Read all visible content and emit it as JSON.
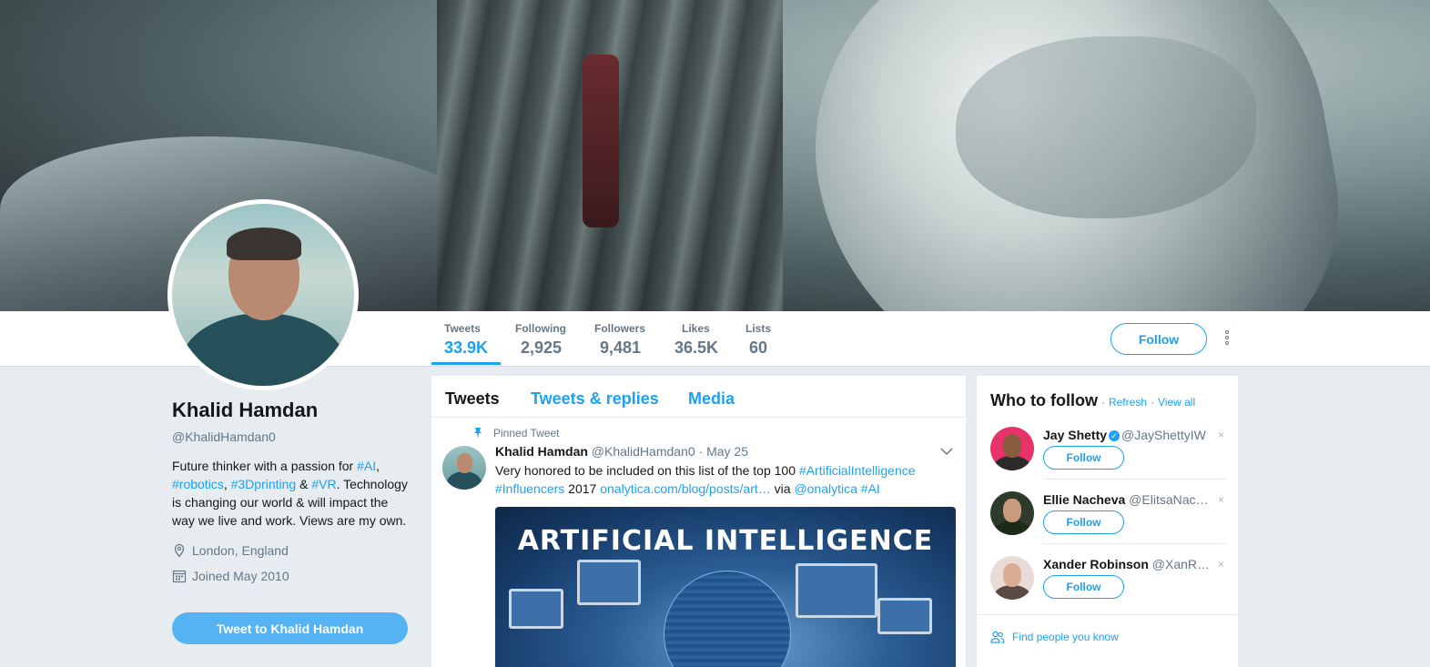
{
  "colors": {
    "accent": "#1da1f2",
    "muted": "#657786",
    "background": "#e6ecf0"
  },
  "profile": {
    "name": "Khalid Hamdan",
    "handle": "@KhalidHamdan0",
    "bio_1": "Future thinker with a passion for ",
    "bio_tag_ai": "#AI",
    "bio_2": ", ",
    "bio_tag_robotics": "#robotics",
    "bio_3": ", ",
    "bio_tag_3d": "#3Dprinting",
    "bio_4": " & ",
    "bio_tag_vr": "#VR",
    "bio_5": ". Technology is changing our world & will impact the way we live and work. Views are my own.",
    "location": "London, England",
    "joined": "Joined May 2010",
    "tweet_to_label": "Tweet to Khalid Hamdan"
  },
  "stats": [
    {
      "label": "Tweets",
      "value": "33.9K"
    },
    {
      "label": "Following",
      "value": "2,925"
    },
    {
      "label": "Followers",
      "value": "9,481"
    },
    {
      "label": "Likes",
      "value": "36.5K"
    },
    {
      "label": "Lists",
      "value": "60"
    }
  ],
  "nav": {
    "follow_label": "Follow"
  },
  "timeline": {
    "tabs": [
      "Tweets",
      "Tweets & replies",
      "Media"
    ],
    "pinned_label": "Pinned Tweet",
    "tweet": {
      "name": "Khalid Hamdan",
      "handle": "@KhalidHamdan0",
      "date": "· May 25",
      "text_1": "Very honored to be included on this list of the top 100 ",
      "tag_1": "#ArtificialIntelligence",
      "tag_2": "#Influencers",
      "text_2": " 2017 ",
      "link": "onalytica.com/blog/posts/art…",
      "text_3": " via ",
      "mention": "@onalytica",
      "tag_3": "#AI",
      "media_title": "ARTIFICIAL INTELLIGENCE"
    }
  },
  "who_to_follow": {
    "title": "Who to follow",
    "sep": "·",
    "refresh": "Refresh",
    "view_all": "View all",
    "users": [
      {
        "name": "Jay Shetty",
        "handle": "@JayShettyIW",
        "verified": true,
        "follow_label": "Follow",
        "dismiss": "×"
      },
      {
        "name": "Ellie Nacheva",
        "handle": "@ElitsaNac…",
        "verified": false,
        "follow_label": "Follow",
        "dismiss": "×"
      },
      {
        "name": "Xander Robinson",
        "handle": "@XanR…",
        "verified": false,
        "follow_label": "Follow",
        "dismiss": "×"
      }
    ],
    "find_people": "Find people you know"
  }
}
